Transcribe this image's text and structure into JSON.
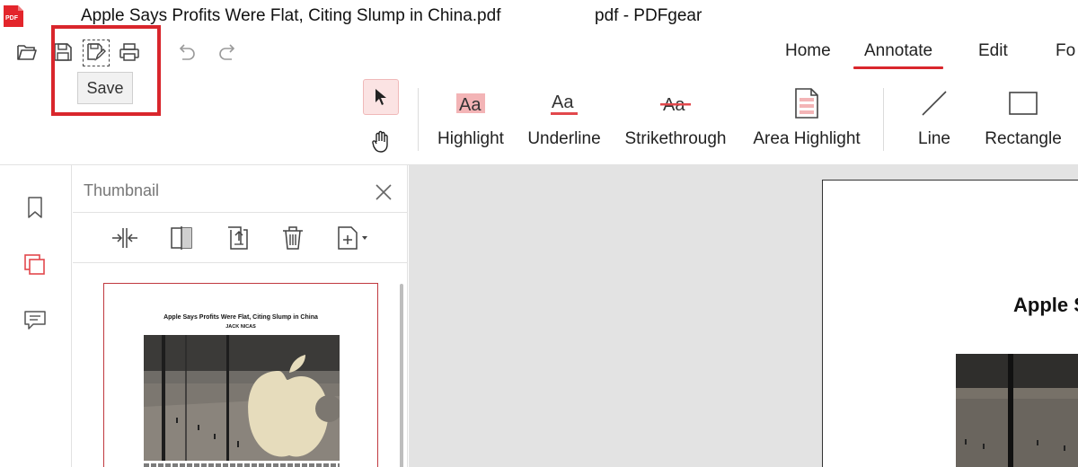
{
  "window": {
    "doc_title": "Apple Says Profits Were Flat, Citing Slump in China.pdf",
    "app_title": "pdf - PDFgear",
    "logo_text": "PDF"
  },
  "quick_access": {
    "items": [
      {
        "name": "open",
        "icon": "folder-open-icon"
      },
      {
        "name": "save",
        "icon": "save-icon"
      },
      {
        "name": "save-as",
        "icon": "save-as-icon"
      },
      {
        "name": "print",
        "icon": "print-icon"
      },
      {
        "name": "undo",
        "icon": "undo-icon"
      },
      {
        "name": "redo",
        "icon": "redo-icon"
      }
    ],
    "tooltip": "Save"
  },
  "ribbon": {
    "tabs": [
      {
        "label": "Home",
        "active": false
      },
      {
        "label": "Annotate",
        "active": true
      },
      {
        "label": "Edit",
        "active": false
      },
      {
        "label": "Fo",
        "active": false
      }
    ],
    "tools": [
      {
        "label": "Highlight",
        "icon": "highlight-icon"
      },
      {
        "label": "Underline",
        "icon": "underline-icon"
      },
      {
        "label": "Strikethrough",
        "icon": "strikethrough-icon"
      },
      {
        "label": "Area Highlight",
        "icon": "area-highlight-icon"
      },
      {
        "label": "Line",
        "icon": "line-icon"
      },
      {
        "label": "Rectangle",
        "icon": "rectangle-icon"
      }
    ],
    "mode": {
      "selected": "select",
      "options": [
        "select-cursor-icon",
        "hand-pan-icon"
      ]
    },
    "accent_color": "#d9262c"
  },
  "left_rail": {
    "items": [
      {
        "name": "bookmarks",
        "icon": "bookmark-icon"
      },
      {
        "name": "thumbnails",
        "icon": "pages-icon",
        "active": true
      },
      {
        "name": "comments",
        "icon": "comment-icon"
      }
    ]
  },
  "thumbnail_panel": {
    "title": "Thumbnail",
    "tools": [
      "merge-pages-icon",
      "split-page-icon",
      "extract-page-icon",
      "delete-page-icon",
      "insert-page-icon"
    ],
    "page": {
      "title": "Apple Says Profits Were Flat, Citing Slump in China",
      "author": "JACK NICAS"
    }
  },
  "document": {
    "heading": "Apple S"
  }
}
